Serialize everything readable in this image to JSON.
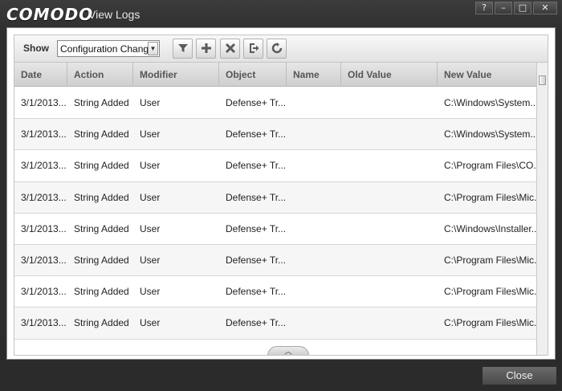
{
  "window": {
    "brand": "COMODO",
    "title": "View Logs",
    "buttons": {
      "help": "?",
      "minimize": "–",
      "maximize": "□",
      "close": "✕"
    }
  },
  "toolbar": {
    "show_label": "Show",
    "filter_select": {
      "selected": "Configuration Changes"
    },
    "icons": [
      "filter-icon",
      "add-icon",
      "remove-icon",
      "export-icon",
      "refresh-icon"
    ]
  },
  "table": {
    "columns": [
      "Date",
      "Action",
      "Modifier",
      "Object",
      "Name",
      "Old Value",
      "New Value"
    ],
    "rows": [
      {
        "date": "3/1/2013...",
        "action": "String Added",
        "modifier": "User",
        "object": "Defense+ Tr...",
        "name": "",
        "old_value": "",
        "new_value": "C:\\Windows\\System..."
      },
      {
        "date": "3/1/2013...",
        "action": "String Added",
        "modifier": "User",
        "object": "Defense+ Tr...",
        "name": "",
        "old_value": "",
        "new_value": "C:\\Windows\\System..."
      },
      {
        "date": "3/1/2013...",
        "action": "String Added",
        "modifier": "User",
        "object": "Defense+ Tr...",
        "name": "",
        "old_value": "",
        "new_value": "C:\\Program Files\\CO..."
      },
      {
        "date": "3/1/2013...",
        "action": "String Added",
        "modifier": "User",
        "object": "Defense+ Tr...",
        "name": "",
        "old_value": "",
        "new_value": "C:\\Program Files\\Mic..."
      },
      {
        "date": "3/1/2013...",
        "action": "String Added",
        "modifier": "User",
        "object": "Defense+ Tr...",
        "name": "",
        "old_value": "",
        "new_value": "C:\\Windows\\Installer..."
      },
      {
        "date": "3/1/2013...",
        "action": "String Added",
        "modifier": "User",
        "object": "Defense+ Tr...",
        "name": "",
        "old_value": "",
        "new_value": "C:\\Program Files\\Mic..."
      },
      {
        "date": "3/1/2013...",
        "action": "String Added",
        "modifier": "User",
        "object": "Defense+ Tr...",
        "name": "",
        "old_value": "",
        "new_value": "C:\\Program Files\\Mic..."
      },
      {
        "date": "3/1/2013...",
        "action": "String Added",
        "modifier": "User",
        "object": "Defense+ Tr...",
        "name": "",
        "old_value": "",
        "new_value": "C:\\Program Files\\Mic..."
      }
    ]
  },
  "footer": {
    "close_label": "Close"
  }
}
